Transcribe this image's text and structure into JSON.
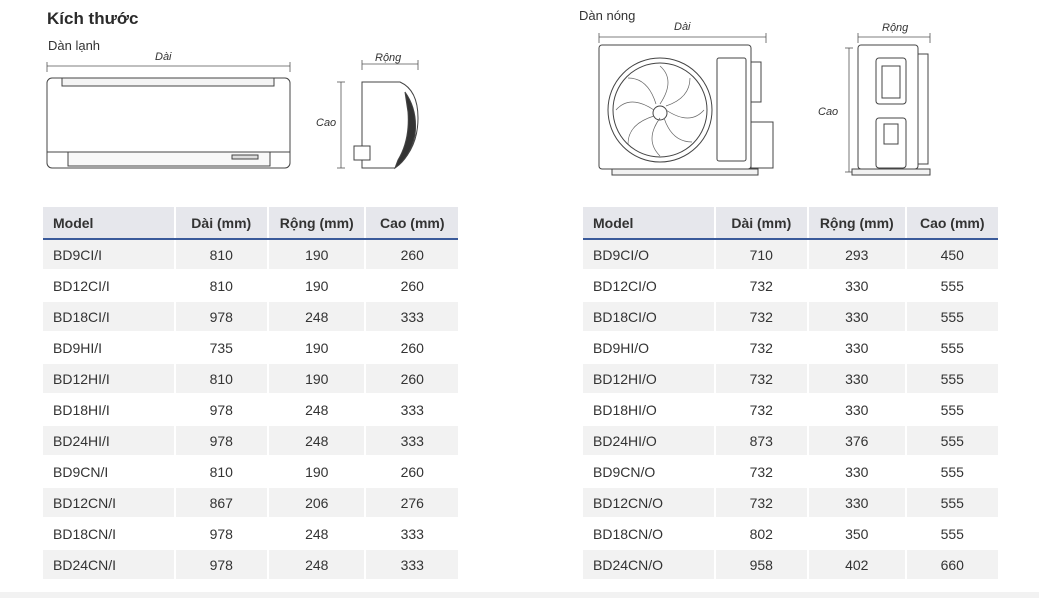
{
  "section_title": "Kích thước",
  "indoor": {
    "label": "Dàn lạnh",
    "dim_length": "Dài",
    "dim_width": "Rộng",
    "dim_height": "Cao"
  },
  "outdoor": {
    "label": "Dàn nóng",
    "dim_length": "Dài",
    "dim_width": "Rộng",
    "dim_height": "Cao"
  },
  "headers": [
    "Model",
    "Dài (mm)",
    "Rộng (mm)",
    "Cao (mm)"
  ],
  "indoor_table": [
    [
      "BD9CI/I",
      "810",
      "190",
      "260"
    ],
    [
      "BD12CI/I",
      "810",
      "190",
      "260"
    ],
    [
      "BD18CI/I",
      "978",
      "248",
      "333"
    ],
    [
      "BD9HI/I",
      "735",
      "190",
      "260"
    ],
    [
      "BD12HI/I",
      "810",
      "190",
      "260"
    ],
    [
      "BD18HI/I",
      "978",
      "248",
      "333"
    ],
    [
      "BD24HI/I",
      "978",
      "248",
      "333"
    ],
    [
      "BD9CN/I",
      "810",
      "190",
      "260"
    ],
    [
      "BD12CN/I",
      "867",
      "206",
      "276"
    ],
    [
      "BD18CN/I",
      "978",
      "248",
      "333"
    ],
    [
      "BD24CN/I",
      "978",
      "248",
      "333"
    ]
  ],
  "outdoor_table": [
    [
      "BD9CI/O",
      "710",
      "293",
      "450"
    ],
    [
      "BD12CI/O",
      "732",
      "330",
      "555"
    ],
    [
      "BD18CI/O",
      "732",
      "330",
      "555"
    ],
    [
      "BD9HI/O",
      "732",
      "330",
      "555"
    ],
    [
      "BD12HI/O",
      "732",
      "330",
      "555"
    ],
    [
      "BD18HI/O",
      "732",
      "330",
      "555"
    ],
    [
      "BD24HI/O",
      "873",
      "376",
      "555"
    ],
    [
      "BD9CN/O",
      "732",
      "330",
      "555"
    ],
    [
      "BD12CN/O",
      "732",
      "330",
      "555"
    ],
    [
      "BD18CN/O",
      "802",
      "350",
      "555"
    ],
    [
      "BD24CN/O",
      "958",
      "402",
      "660"
    ]
  ],
  "colors": {
    "header_bg": "#e6e7ec",
    "header_rule": "#3a5a9a",
    "row_stripe": "#f2f2f2"
  }
}
